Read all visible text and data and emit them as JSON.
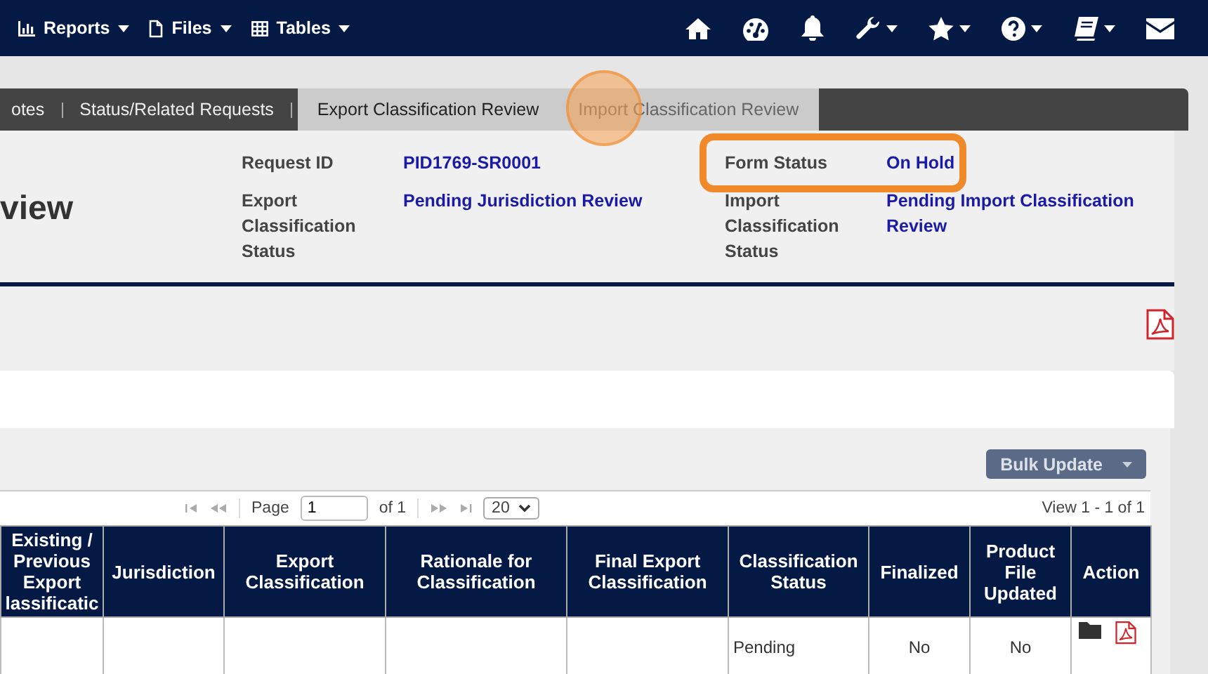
{
  "nav": {
    "menus": [
      {
        "label": "Reports"
      },
      {
        "label": "Files"
      },
      {
        "label": "Tables"
      }
    ],
    "tools": [
      {
        "dropdown": false
      },
      {
        "dropdown": false
      },
      {
        "dropdown": false
      },
      {
        "dropdown": true
      },
      {
        "dropdown": true
      },
      {
        "dropdown": true
      },
      {
        "dropdown": true
      },
      {
        "dropdown": false
      }
    ]
  },
  "tab_groups": [
    {
      "kind": "dark",
      "tabs": [
        {
          "label": "otes",
          "selected": false
        },
        {
          "label": "Status/Related Requests",
          "selected": false
        }
      ]
    },
    {
      "kind": "light",
      "tabs": [
        {
          "label": "Export Classification Review",
          "selected": true
        },
        {
          "label": "Import Classification Review",
          "selected": false
        }
      ]
    }
  ],
  "title": "view",
  "fields": [
    {
      "label": "Request ID",
      "value": "PID1769-SR0001"
    },
    {
      "label": "Form Status",
      "value": "On Hold",
      "highlighted": true
    },
    {
      "label": "Export Classification Status",
      "value": "Pending Jurisdiction Review"
    },
    {
      "label": "Import Classification Status",
      "value": "Pending Import Classification Review"
    }
  ],
  "bulk_button": "Bulk Update",
  "pager": {
    "page_label": "Page",
    "page": "1",
    "of": "of 1",
    "page_size": "20",
    "view": "View 1 - 1 of 1"
  },
  "table": {
    "columns": [
      "Existing / Previous Export lassificatic",
      "Jurisdiction",
      "Export Classification",
      "Rationale for Classification",
      "Final Export Classification",
      "Classification Status",
      "Finalized",
      "Product File Updated",
      "Action"
    ],
    "rows": [
      {
        "cells": [
          "",
          "",
          "",
          "",
          "",
          "Pending",
          "No",
          "No"
        ]
      }
    ]
  }
}
